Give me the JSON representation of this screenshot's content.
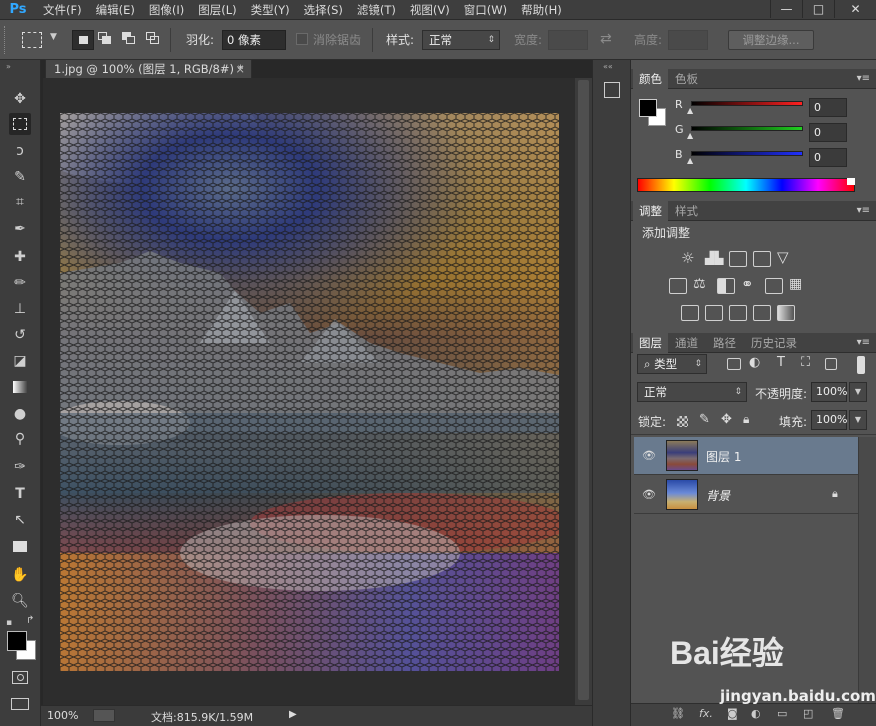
{
  "app": {
    "logo": "Ps"
  },
  "menu": [
    "文件(F)",
    "编辑(E)",
    "图像(I)",
    "图层(L)",
    "类型(Y)",
    "选择(S)",
    "滤镜(T)",
    "视图(V)",
    "窗口(W)",
    "帮助(H)"
  ],
  "window_controls": {
    "minimize": "—",
    "maximize": "□",
    "close": "✕"
  },
  "options": {
    "feather_label": "羽化:",
    "feather_value": "0 像素",
    "antialias_label": "消除锯齿",
    "style_label": "样式:",
    "style_value": "正常",
    "width_label": "宽度:",
    "height_label": "高度:",
    "refine_edge": "调整边缘..."
  },
  "document": {
    "tab_title": "1.jpg @ 100% (图层 1, RGB/8#) *",
    "tab_close": "×"
  },
  "status": {
    "zoom": "100%",
    "doc_info": "文档:815.9K/1.59M",
    "arrow": "▶"
  },
  "color_panel": {
    "tabs": [
      "颜色",
      "色板"
    ],
    "channels": [
      {
        "label": "R",
        "value": "0",
        "color": "#e03030"
      },
      {
        "label": "G",
        "value": "0",
        "color": "#30d030"
      },
      {
        "label": "B",
        "value": "0",
        "color": "#3040e0"
      }
    ]
  },
  "adjust_panel": {
    "tabs": [
      "调整",
      "样式"
    ],
    "title": "添加调整"
  },
  "layers_panel": {
    "tabs": [
      "图层",
      "通道",
      "路径",
      "历史记录"
    ],
    "filter_kind": "类型",
    "blend_mode": "正常",
    "opacity_label": "不透明度:",
    "opacity_value": "100%",
    "lock_label": "锁定:",
    "fill_label": "填充:",
    "fill_value": "100%",
    "layers": [
      {
        "name": "图层 1",
        "selected": true
      },
      {
        "name": "背景",
        "selected": false
      }
    ],
    "footer_icons": [
      "link-icon",
      "fx",
      "mask-icon",
      "adjustment-icon",
      "folder-icon",
      "new-layer-icon",
      "trash-icon"
    ],
    "fx_label": "fx."
  },
  "watermark": {
    "text": "Bai经验",
    "url": "jingyan.baidu.com"
  }
}
